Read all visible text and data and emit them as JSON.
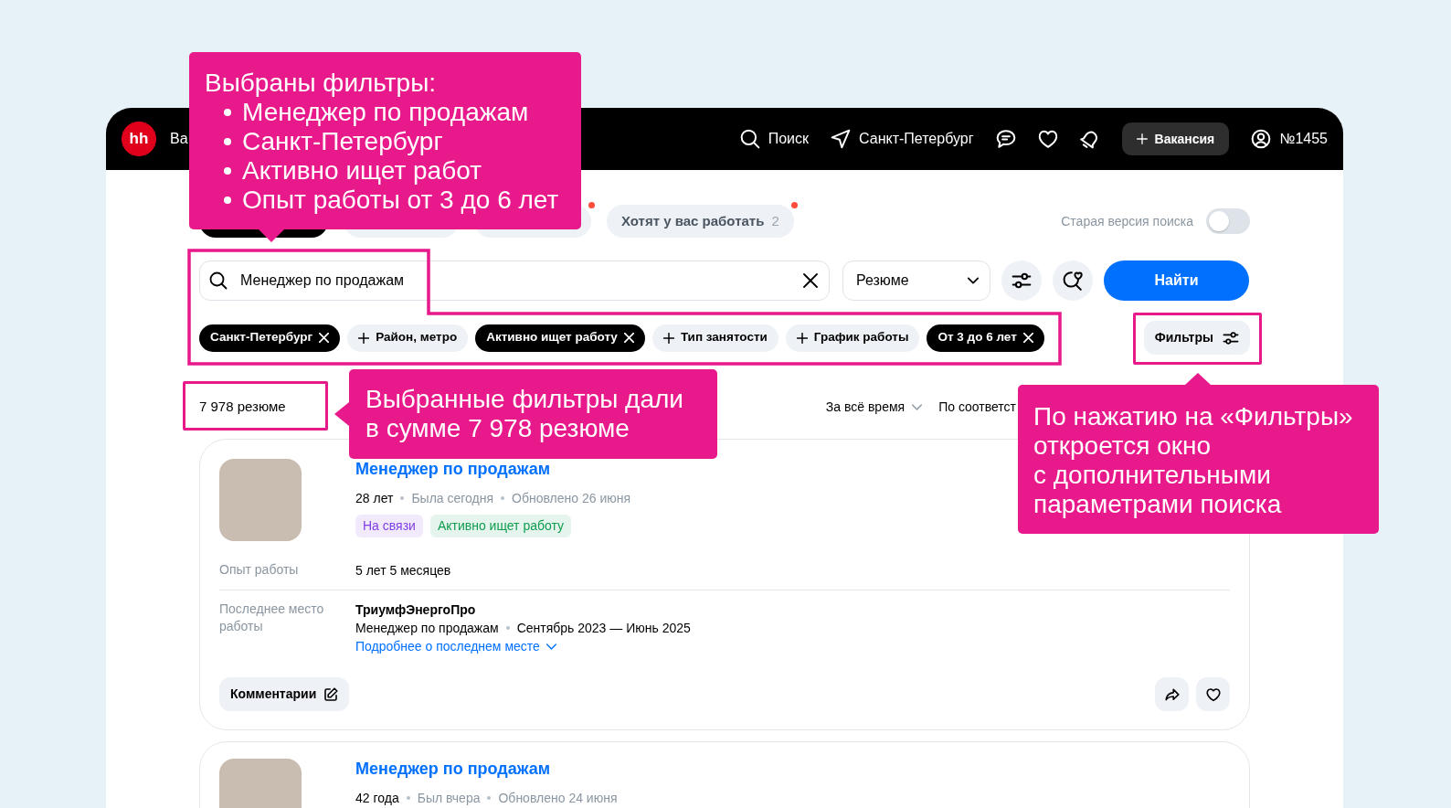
{
  "header": {
    "logo": "hh",
    "menu_item": "Ва",
    "links": [
      "Поиск",
      "Санкт-Петербург"
    ],
    "post_button": "Вакансия",
    "account": "№1455"
  },
  "tabs": [
    {
      "selected": true,
      "new": false
    },
    {
      "selected": false,
      "new": false
    },
    {
      "selected": false,
      "new": true
    },
    {
      "label": "Хотят у вас работать",
      "count": "2",
      "selected": false,
      "new": true
    }
  ],
  "old_search_toggle": {
    "label": "Старая версия поиска",
    "on": false
  },
  "search": {
    "value": "Менеджер по продажам",
    "type": "Резюме",
    "submit": "Найти"
  },
  "filter_chips": [
    {
      "label": "Санкт-Петербург",
      "applied": true
    },
    {
      "label": "Район, метро",
      "applied": false
    },
    {
      "label": "Активно ищет работу",
      "applied": true
    },
    {
      "label": "Тип занятости",
      "applied": false
    },
    {
      "label": "График работы",
      "applied": false
    },
    {
      "label": "От 3 до 6 лет",
      "applied": true
    }
  ],
  "filters_button": "Фильтры",
  "results": {
    "count": "7 978 резюме",
    "period": "За всё время",
    "sort": "По соответст"
  },
  "resumes": [
    {
      "title": "Менеджер по продажам",
      "age": "28 лет",
      "last_seen": "Была сегодня",
      "updated": "Обновлено 26 июня",
      "badges": [
        {
          "label": "На связи",
          "color": "#7f3fe0"
        },
        {
          "label": "Активно ищет работу",
          "color": "#0f9d4f"
        }
      ],
      "experience_label": "Опыт работы",
      "experience": "5 лет 5 месяцев",
      "last_job_label": "Последнее место работы",
      "company": "ТриумфЭнергоПро",
      "position": "Менеджер по продажам",
      "period": "Сентябрь 2023 — Июнь 2025",
      "more_link": "Подробнее о последнем месте",
      "comments_button": "Комментарии"
    },
    {
      "title": "Менеджер по продажам",
      "age": "42 года",
      "last_seen": "Был вчера",
      "updated": "Обновлено 24 июня"
    }
  ],
  "callouts": [
    {
      "kind": "list",
      "title": "Выбраны фильтры:",
      "items": [
        "Менеджер по продажам",
        "Санкт-Петербург",
        "Активно ищет работ",
        "Опыт работы от 3 до 6 лет"
      ]
    },
    {
      "kind": "note",
      "lines": [
        "Выбранные фильтры дали",
        "в сумме 7 978 резюме"
      ]
    },
    {
      "kind": "note",
      "lines": [
        "По нажатию на «Фильтры»",
        "откроется окно",
        "с дополнительными",
        "параметрами поиска"
      ]
    }
  ]
}
